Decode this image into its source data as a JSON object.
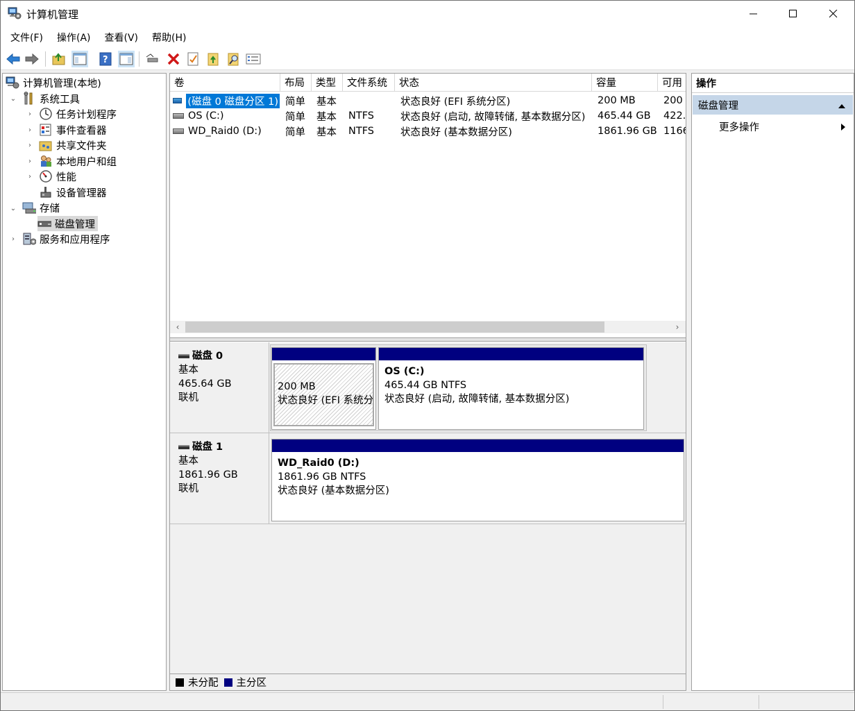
{
  "window": {
    "title": "计算机管理"
  },
  "menu": [
    "文件(F)",
    "操作(A)",
    "查看(V)",
    "帮助(H)"
  ],
  "toolbar": {
    "icons": [
      "back-icon",
      "forward-icon",
      "up-folder-icon",
      "show-hide-tree-icon",
      "help-icon",
      "show-hide-action-pane-icon",
      "connect-drive-icon",
      "delete-icon",
      "properties-icon",
      "open-folder-icon",
      "search-icon",
      "settings-list-icon"
    ]
  },
  "tree": {
    "root": "计算机管理(本地)",
    "system_tools": "系统工具",
    "task_scheduler": "任务计划程序",
    "event_viewer": "事件查看器",
    "shared_folders": "共享文件夹",
    "local_users": "本地用户和组",
    "performance": "性能",
    "device_manager": "设备管理器",
    "storage": "存储",
    "disk_management": "磁盘管理",
    "services_apps": "服务和应用程序"
  },
  "volumes": {
    "columns": [
      "卷",
      "布局",
      "类型",
      "文件系统",
      "状态",
      "容量",
      "可用"
    ],
    "rows": [
      [
        "(磁盘 0 磁盘分区 1)",
        "简单",
        "基本",
        "",
        "状态良好 (EFI 系统分区)",
        "200 MB",
        "200"
      ],
      [
        "OS (C:)",
        "简单",
        "基本",
        "NTFS",
        "状态良好 (启动, 故障转储, 基本数据分区)",
        "465.44 GB",
        "422."
      ],
      [
        "WD_Raid0 (D:)",
        "简单",
        "基本",
        "NTFS",
        "状态良好 (基本数据分区)",
        "1861.96 GB",
        "1166"
      ]
    ]
  },
  "disks": [
    {
      "name": "磁盘 0",
      "type": "基本",
      "size": "465.64 GB",
      "status": "联机",
      "partitions": [
        {
          "name": "",
          "size": "200 MB",
          "status": "状态良好 (EFI 系统分"
        },
        {
          "name": "OS  (C:)",
          "size": "465.44 GB NTFS",
          "status": "状态良好 (启动, 故障转储, 基本数据分区)"
        }
      ]
    },
    {
      "name": "磁盘 1",
      "type": "基本",
      "size": "1861.96 GB",
      "status": "联机",
      "partitions": [
        {
          "name": "WD_Raid0  (D:)",
          "size": "1861.96 GB NTFS",
          "status": "状态良好 (基本数据分区)"
        }
      ]
    }
  ],
  "legend": {
    "unallocated": "未分配",
    "primary": "主分区",
    "unallocated_color": "#000000",
    "primary_color": "#000080"
  },
  "actions": {
    "header": "操作",
    "section": "磁盘管理",
    "more": "更多操作"
  },
  "colors": {
    "selection": "#0078d7",
    "action_section": "#c5d6e8",
    "partition_bar": "#000080"
  }
}
